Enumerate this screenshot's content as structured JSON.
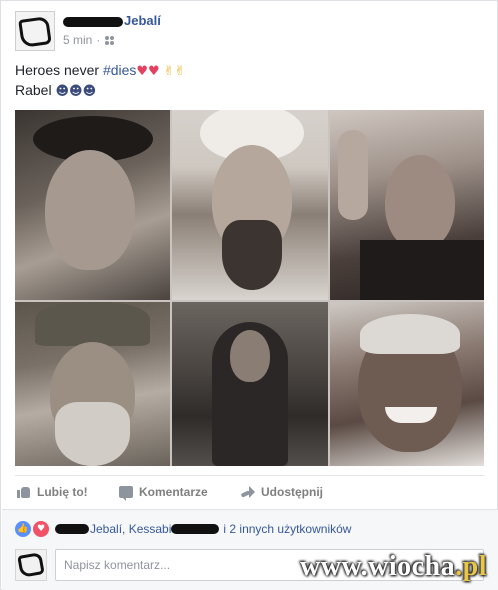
{
  "post": {
    "author_visible": "Jebalí",
    "time": "5 min",
    "audience_icon": "friends-icon",
    "text_line1_prefix": "Heroes never ",
    "hashtag": "#dies",
    "line1_emoji_hearts": "♥♥",
    "line1_emoji_hands": "✌✌",
    "text_line2": "Rabel",
    "line2_emoji": "☻☻☻"
  },
  "actions": {
    "like_label": "Lubię to!",
    "comment_label": "Komentarze",
    "share_label": "Udostępnij"
  },
  "reactions": {
    "icons": [
      "like-icon",
      "love-icon"
    ],
    "name1_visible": "Jebalí, Kessabi",
    "others_text": "i 2 innych użytkowników"
  },
  "composer": {
    "placeholder": "Napisz komentarz..."
  },
  "watermark": {
    "main": "www.wiocha",
    "tld": ".pl"
  },
  "colors": {
    "link": "#365899",
    "muted": "#90949c",
    "like_blue": "#5890ff",
    "love_red": "#f25268"
  }
}
